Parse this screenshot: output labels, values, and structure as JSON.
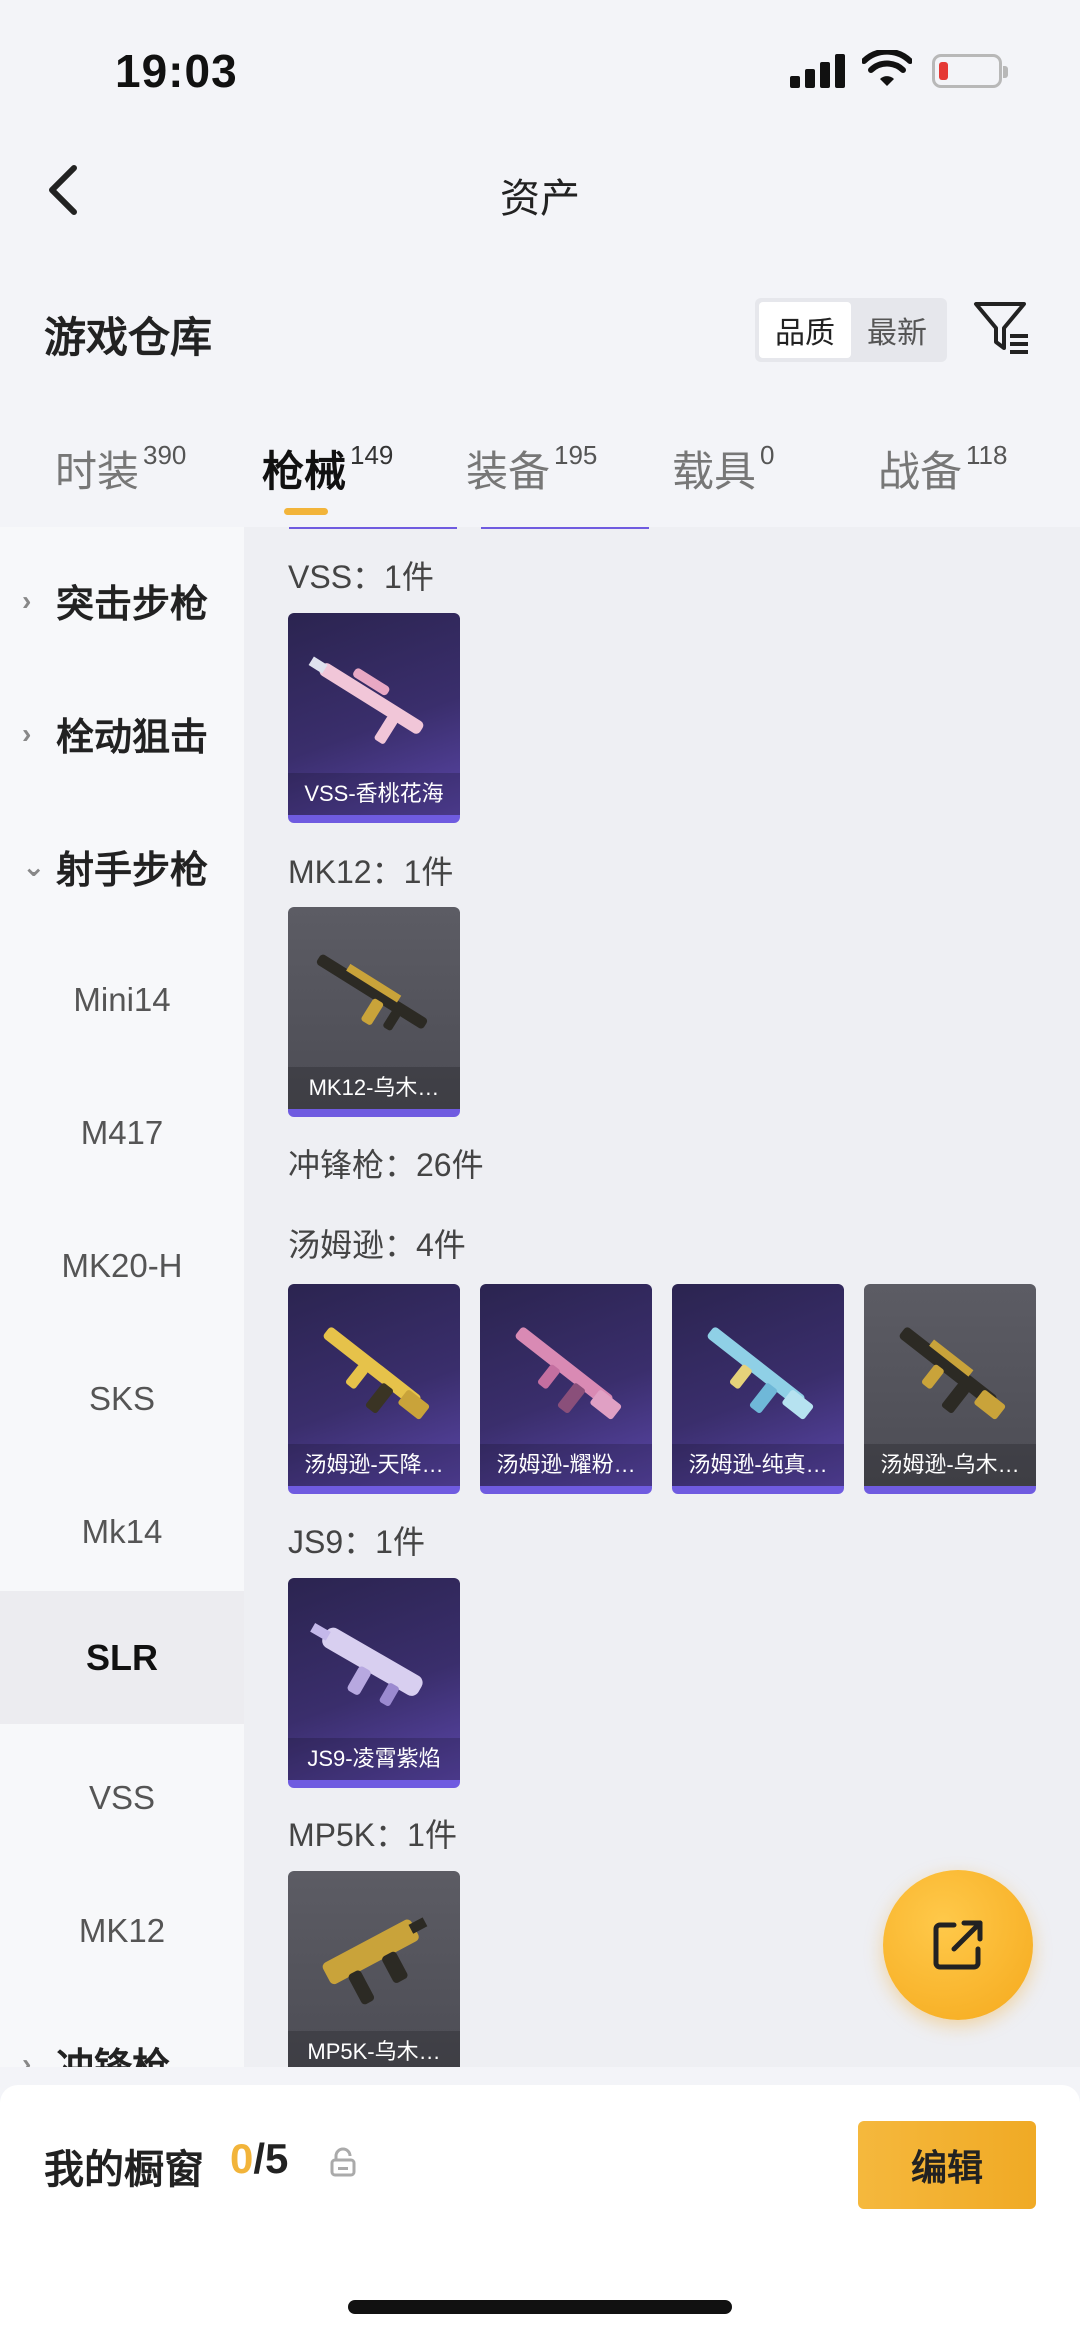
{
  "status_bar": {
    "time": "19:03",
    "battery_level": 0.15
  },
  "nav": {
    "title": "资产"
  },
  "warehouse": {
    "title": "游戏仓库",
    "sort_options": [
      "品质",
      "最新"
    ],
    "active_sort": "品质"
  },
  "tabs": [
    {
      "label": "时装",
      "count": "390"
    },
    {
      "label": "枪械",
      "count": "149"
    },
    {
      "label": "装备",
      "count": "195"
    },
    {
      "label": "载具",
      "count": "0"
    },
    {
      "label": "战备",
      "count": "118"
    }
  ],
  "active_tab": "枪械",
  "sidebar": {
    "items": [
      {
        "label": "突击步枪",
        "type": "category",
        "chevron": "›"
      },
      {
        "label": "栓动狙击",
        "type": "category",
        "chevron": "›"
      },
      {
        "label": "射手步枪",
        "type": "category",
        "chevron": "⌄"
      },
      {
        "label": "Mini14",
        "type": "sub"
      },
      {
        "label": "M417",
        "type": "sub"
      },
      {
        "label": "MK20-H",
        "type": "sub"
      },
      {
        "label": "SKS",
        "type": "sub"
      },
      {
        "label": "Mk14",
        "type": "sub"
      },
      {
        "label": "SLR",
        "type": "sub"
      },
      {
        "label": "VSS",
        "type": "sub"
      },
      {
        "label": "MK12",
        "type": "sub"
      },
      {
        "label": "冲锋枪",
        "type": "category",
        "chevron": "›"
      }
    ],
    "active_item": "SLR"
  },
  "content": {
    "groups": [
      {
        "label": "VSS：1件",
        "items": [
          {
            "name": "VSS-香桃花海",
            "style": "purple",
            "icon": "sniper-rifle-pink-icon"
          }
        ]
      },
      {
        "label": "MK12：1件",
        "items": [
          {
            "name": "MK12-乌木…",
            "style": "gray",
            "icon": "rifle-gold-icon"
          }
        ]
      },
      {
        "label": "冲锋枪：26件",
        "items": []
      },
      {
        "label": "汤姆逊：4件",
        "items": [
          {
            "name": "汤姆逊-天降…",
            "style": "purple",
            "icon": "smg-gold-icon"
          },
          {
            "name": "汤姆逊-耀粉…",
            "style": "purple",
            "icon": "smg-pink-icon"
          },
          {
            "name": "汤姆逊-纯真…",
            "style": "purple",
            "icon": "smg-blue-icon"
          },
          {
            "name": "汤姆逊-乌木…",
            "style": "gray",
            "icon": "smg-gold-icon"
          }
        ]
      },
      {
        "label": "JS9：1件",
        "items": [
          {
            "name": "JS9-凌霄紫焰",
            "style": "purple",
            "icon": "smg-violet-icon"
          }
        ]
      },
      {
        "label": "MP5K：1件",
        "items": [
          {
            "name": "MP5K-乌木…",
            "style": "gray",
            "icon": "pistol-smg-gold-icon"
          }
        ]
      }
    ]
  },
  "showcase": {
    "title": "我的橱窗",
    "current": "0",
    "total": "/5",
    "edit_label": "编辑"
  },
  "colors": {
    "accent": "#f2b43a",
    "card_purple": "#3a2e6c",
    "card_gray": "#55555d",
    "card_bottom_bar": "#6f5be0"
  }
}
